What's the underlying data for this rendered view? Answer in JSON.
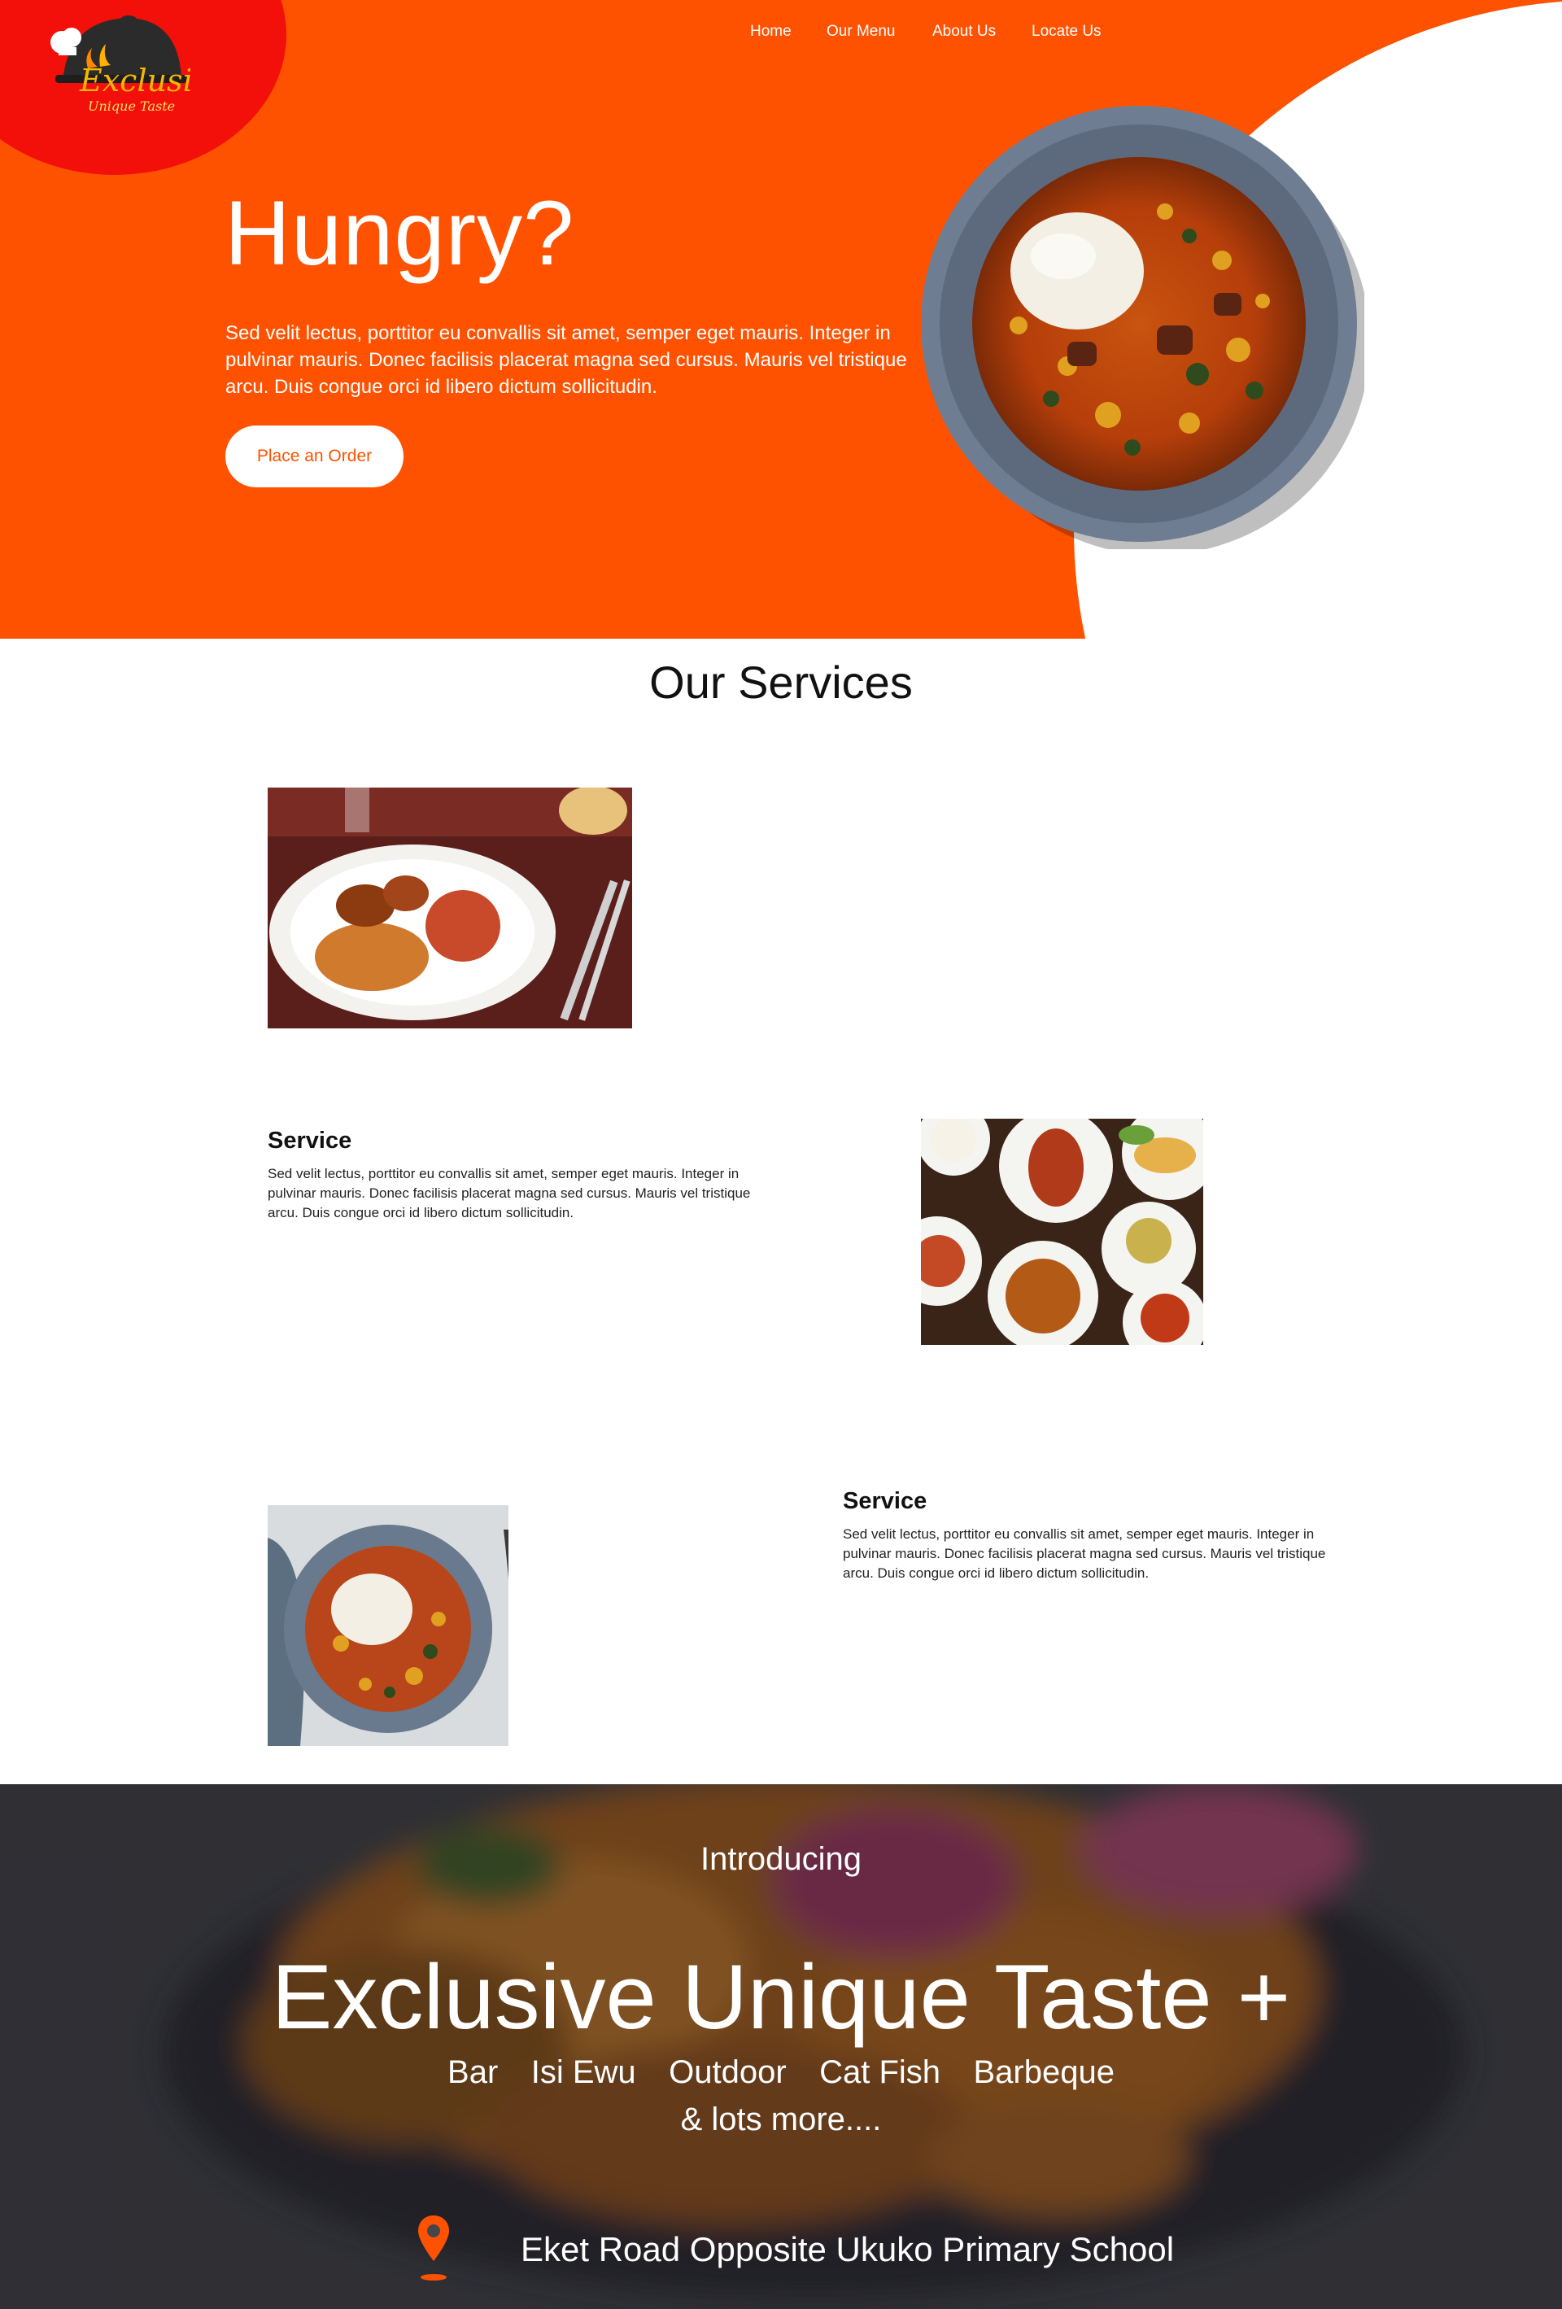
{
  "brand": {
    "logo_text": "Exclusive",
    "logo_subtext": "Unique Taste",
    "colors": {
      "primary": "#ff5200",
      "logo_disc": "#f30f0a",
      "background": "#ffffff"
    }
  },
  "nav": {
    "items": [
      {
        "label": "Home"
      },
      {
        "label": "Our Menu"
      },
      {
        "label": "About Us"
      },
      {
        "label": "Locate Us"
      }
    ]
  },
  "hero": {
    "title": "Hungry?",
    "text": "Sed velit lectus, porttitor eu convallis sit amet, semper eget mauris. Integer  in pulvinar mauris. Donec facilisis placerat magna sed cursus. Mauris vel tristique arcu. Duis congue orci id libero dictum sollicitudin.",
    "cta_label": "Place an Order"
  },
  "services": {
    "title": "Our Services",
    "items": [
      {
        "heading": "Service",
        "text": "Sed velit lectus, porttitor eu convallis sit amet, semper eget mauris. Integer  in pulvinar mauris. Donec facilisis placerat magna sed cursus. Mauris vel tristique arcu. Duis congue orci id libero dictum sollicitudin."
      },
      {
        "heading": "Service",
        "text": "Sed velit lectus, porttitor eu convallis sit amet, semper eget mauris. Integer  in pulvinar mauris. Donec facilisis placerat magna sed cursus. Mauris vel tristique arcu. Duis congue orci id libero dictum sollicitudin."
      }
    ]
  },
  "promo": {
    "intro": "Introducing",
    "headline": "Exclusive Unique Taste +",
    "menu": [
      "Bar",
      "Isi Ewu",
      "Outdoor",
      "Cat Fish",
      "Barbeque"
    ],
    "more": "& lots more....",
    "address": "Eket Road Opposite Ukuko Primary School",
    "address_icon": "map-pin-icon"
  }
}
